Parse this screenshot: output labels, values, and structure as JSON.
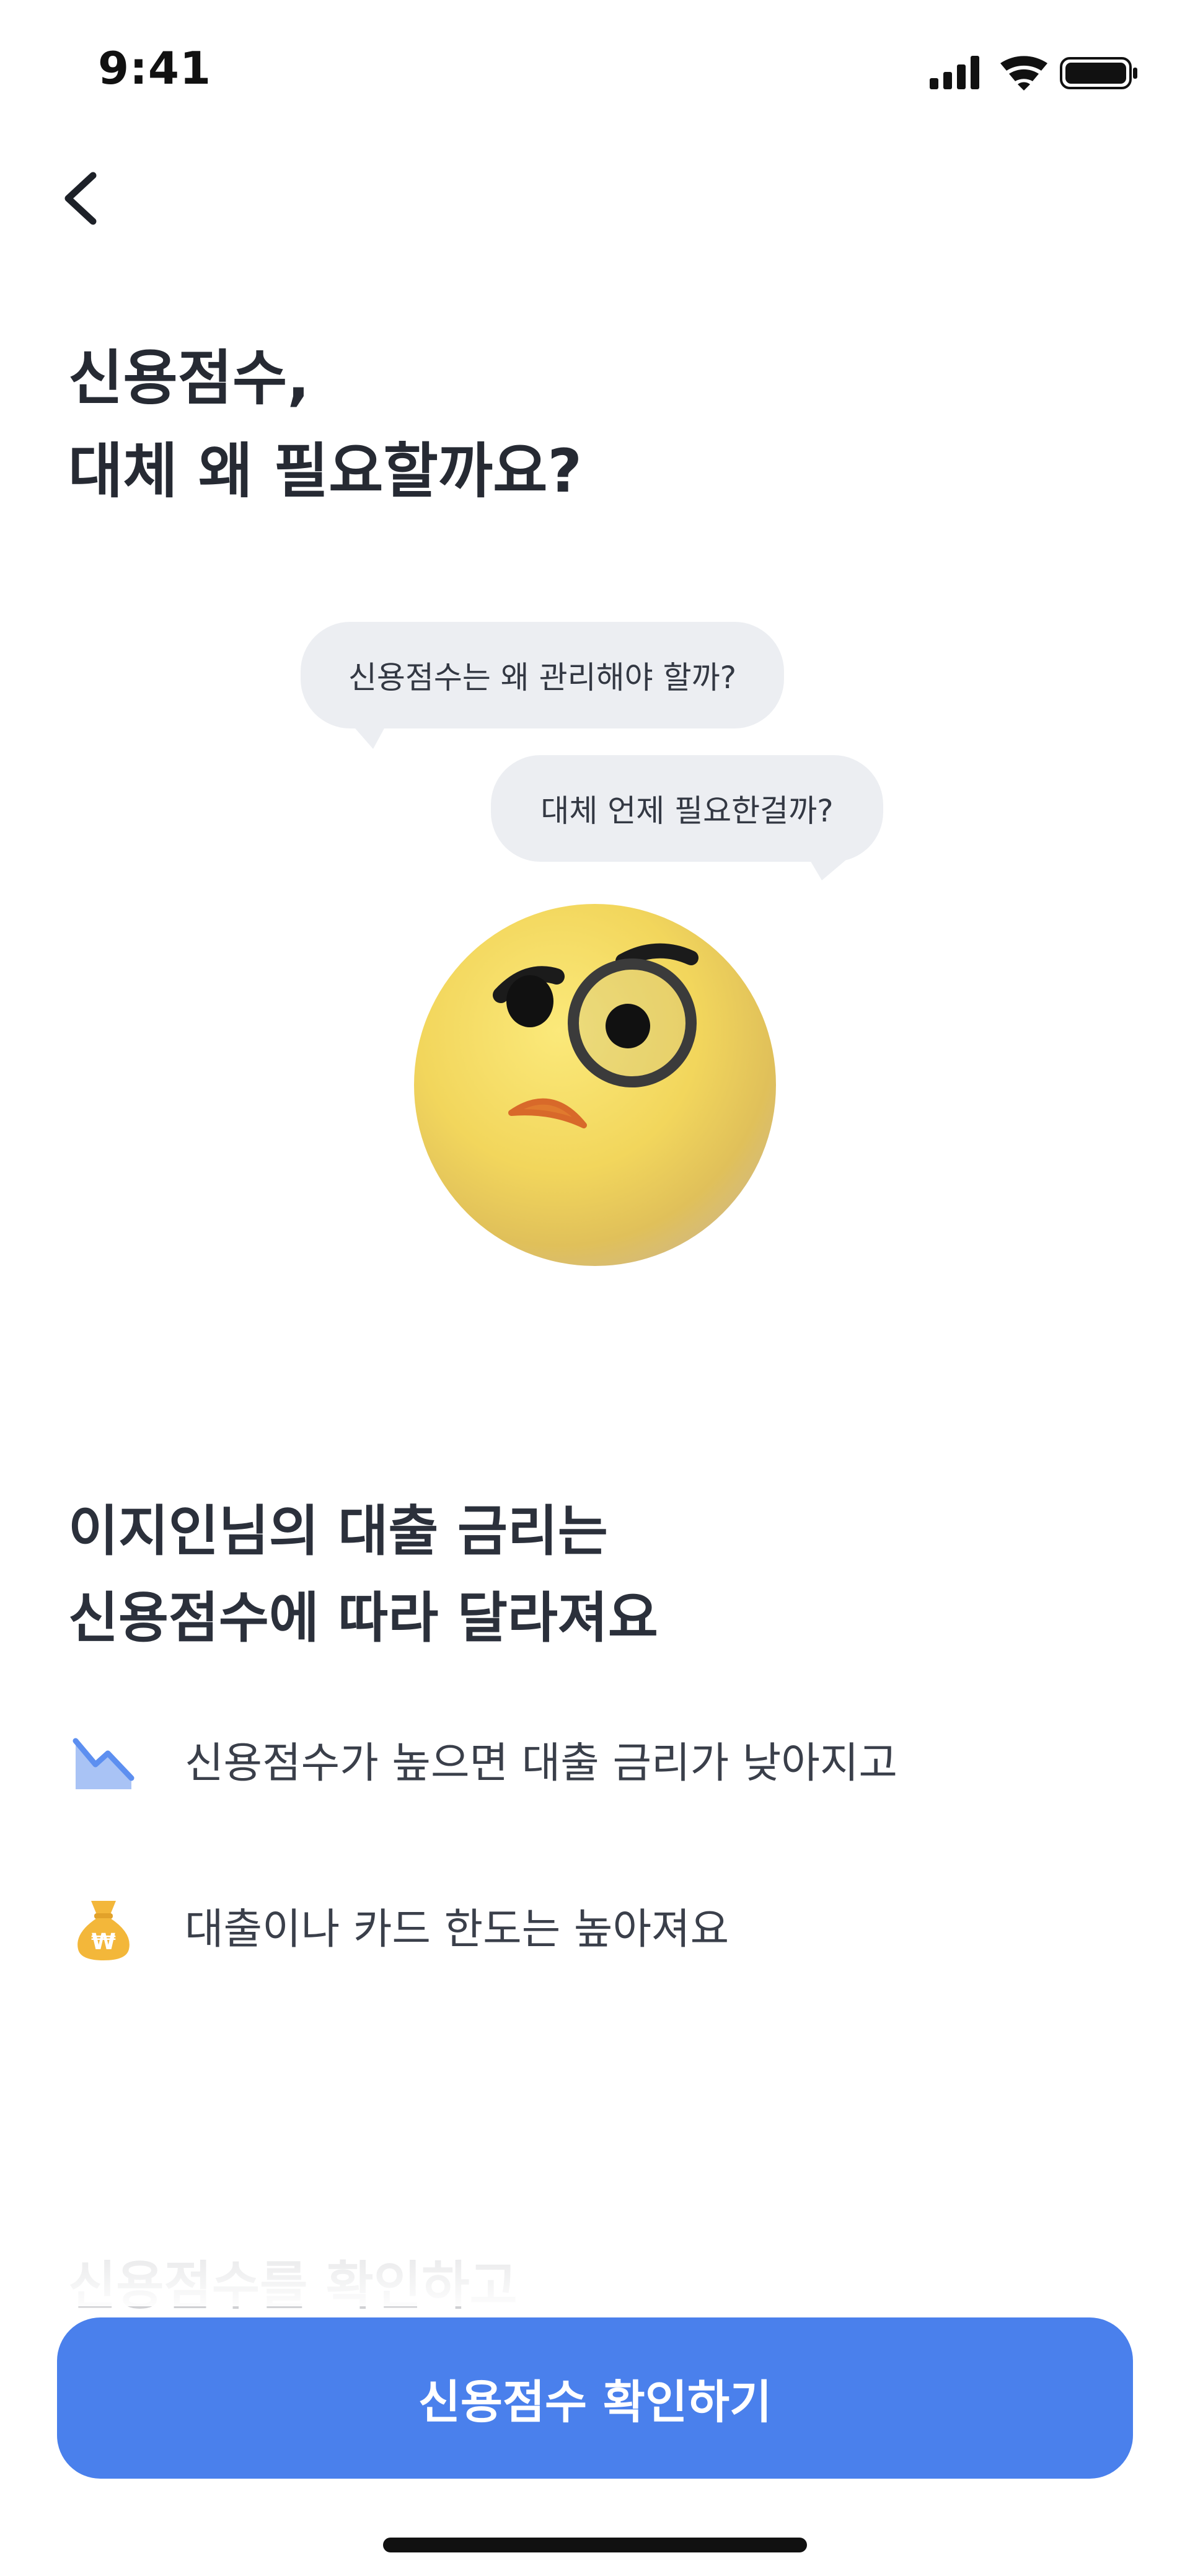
{
  "status_bar": {
    "time": "9:41",
    "icons": [
      "cellular-signal-icon",
      "wifi-icon",
      "battery-icon"
    ]
  },
  "nav": {
    "back_icon": "chevron-left-icon"
  },
  "header": {
    "title_line1": "신용점수,",
    "title_line2": "대체 왜 필요할까요?"
  },
  "illustration": {
    "bubble_1": "신용점수는 왜 관리해야 할까?",
    "bubble_2": "대체 언제 필요한걸까?",
    "emoji_icon": "monocle-face-icon"
  },
  "section": {
    "title_line1": "이지인님의 대출 금리는",
    "title_line2": "신용점수에 따라 달라져요",
    "features": [
      {
        "icon": "chart-down-icon",
        "text": "신용점수가 높으면 대출 금리가 낮아지고"
      },
      {
        "icon": "money-bag-icon",
        "text": "대출이나 카드 한도는 높아져요"
      }
    ],
    "faded_text": "신용점수를 확인하고"
  },
  "cta": {
    "label": "신용점수 확인하기"
  },
  "colors": {
    "primary": "#4a80ec",
    "bubble_bg": "#eceef2",
    "text_dark": "#2b303b"
  }
}
